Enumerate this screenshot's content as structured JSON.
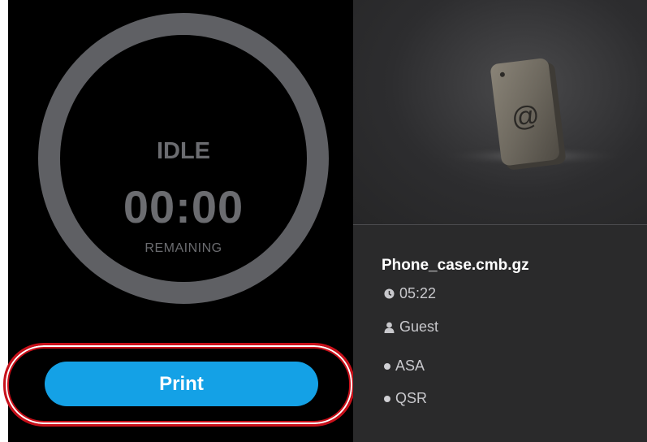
{
  "status": {
    "state": "IDLE",
    "time": "00:00",
    "remaining_label": "REMAINING"
  },
  "actions": {
    "print_label": "Print"
  },
  "job": {
    "file_name": "Phone_case.cmb.gz",
    "duration": "05:22",
    "owner": "Guest",
    "tags": [
      "ASA",
      "QSR"
    ]
  },
  "colors": {
    "accent": "#14a1e6",
    "highlight": "#c8101a",
    "ring": "#5f6064",
    "panel": "#2a2a2b"
  },
  "icons": {
    "duration": "clock-icon",
    "owner": "user-icon",
    "tag": "dot-icon"
  }
}
